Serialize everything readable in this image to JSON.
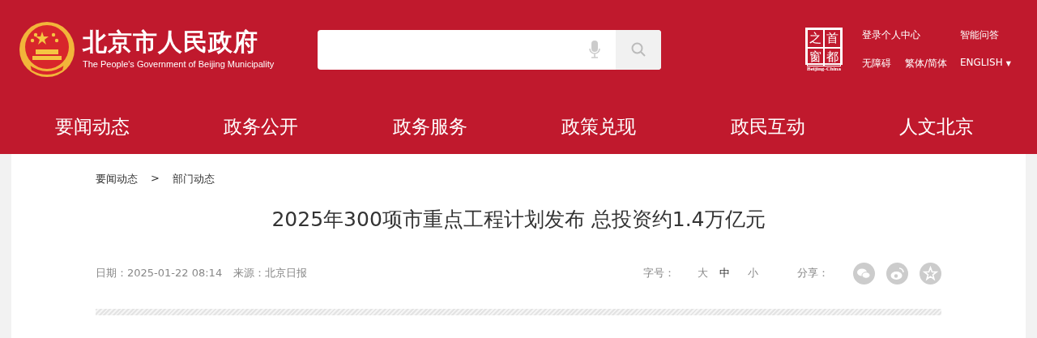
{
  "header": {
    "site_title": "北京市人民政府",
    "site_subtitle": "The People's Government of Beijing Municipality",
    "portal_logo": {
      "characters": [
        "之",
        "首",
        "窗",
        "都"
      ],
      "caption": "Beijing-China"
    },
    "links_top": [
      "登录个人中心",
      "智能问答"
    ],
    "links_bottom": [
      "无障碍",
      "繁体/简体",
      "ENGLISH"
    ],
    "dropdown_arrow": "▼"
  },
  "nav": [
    {
      "label": "要闻动态",
      "selected": false
    },
    {
      "label": "政务公开",
      "selected": false
    },
    {
      "label": "政务服务",
      "selected": false
    },
    {
      "label": "政策兑现",
      "selected": false
    },
    {
      "label": "政民互动",
      "selected": false
    },
    {
      "label": "人文北京",
      "selected": false
    }
  ],
  "breadcrumb": {
    "items": [
      "要闻动态",
      "部门动态"
    ],
    "separator": ">"
  },
  "article": {
    "title": "2025年300项市重点工程计划发布 总投资约1.4万亿元",
    "date_label": "日期：",
    "date": "2025-01-22 08:14",
    "source_label": "来源：",
    "source": "北京日报",
    "font_size_label": "字号：",
    "font_sizes": [
      {
        "label": "大",
        "selected": false
      },
      {
        "label": "中",
        "selected": true
      },
      {
        "label": "小",
        "selected": false
      }
    ],
    "share_label": "分享："
  }
}
